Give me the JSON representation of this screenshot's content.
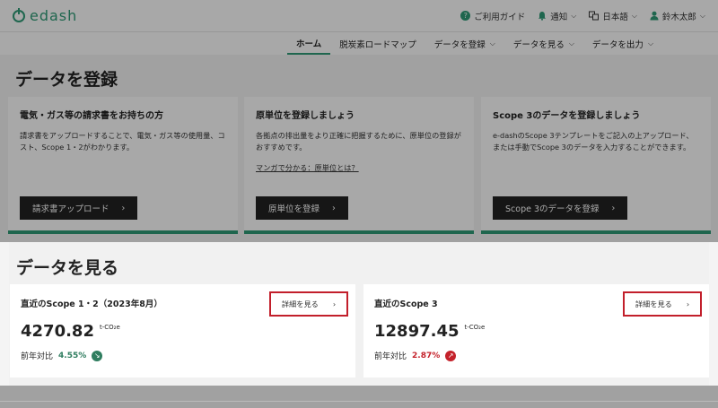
{
  "header": {
    "logo": "edash",
    "guide": "ご利用ガイド",
    "notice": "通知",
    "language": "日本語",
    "user": "鈴木太郎"
  },
  "nav": {
    "items": [
      {
        "label": "ホーム",
        "active": true
      },
      {
        "label": "脱炭素ロードマップ"
      },
      {
        "label": "データを登録",
        "dropdown": true
      },
      {
        "label": "データを見る",
        "dropdown": true
      },
      {
        "label": "データを出力",
        "dropdown": true
      }
    ]
  },
  "register": {
    "title": "データを登録",
    "cards": [
      {
        "title": "電気・ガス等の請求書をお持ちの方",
        "description": "請求書をアップロードすることで、電気・ガス等の使用量、コスト、Scope 1・2がわかります。",
        "button": "請求書アップロード"
      },
      {
        "title": "原単位を登録しましょう",
        "description": "各拠点の排出量をより正確に把握するために、原単位の登録がおすすめです。",
        "link": "マンガで分かる：原単位とは？",
        "button": "原単位を登録"
      },
      {
        "title": "Scope 3のデータを登録しましょう",
        "description": "e-dashのScope 3テンプレートをご記入の上アップロード、または手動でScope 3のデータを入力することができます。",
        "button": "Scope 3のデータを登録"
      }
    ]
  },
  "view": {
    "title": "データを見る",
    "cards": [
      {
        "title": "直近のScope 1・2（2023年8月）",
        "value": "4270.82",
        "unit": "t-CO₂e",
        "compare_label": "前年対比",
        "compare_value": "4.55%",
        "detail_button": "詳細を見る",
        "trend": "down"
      },
      {
        "title": "直近のScope 3",
        "value": "12897.45",
        "unit": "t-CO₂e",
        "compare_label": "前年対比",
        "compare_value": "2.87%",
        "detail_button": "詳細を見る",
        "trend": "up"
      }
    ]
  },
  "colors": {
    "brand": "#2f9c77",
    "decrease": "#2f7d5f",
    "increase": "#c4222b",
    "highlight": "#c21f2b"
  }
}
